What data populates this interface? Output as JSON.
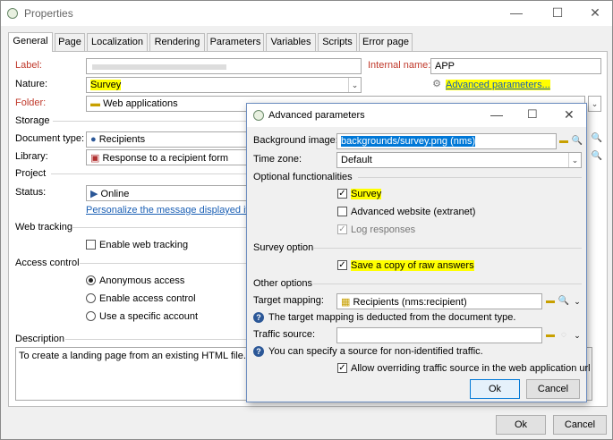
{
  "window": {
    "title": "Properties",
    "minimize": "—",
    "maximize": "☐",
    "close": "✕"
  },
  "tabs": [
    "General",
    "Page",
    "Localization",
    "Rendering",
    "Parameters",
    "Variables",
    "Scripts",
    "Error page"
  ],
  "general": {
    "label_label": "Label:",
    "label_value": "",
    "internal_name_label": "Internal name:",
    "internal_name_value": "APP",
    "nature_label": "Nature:",
    "nature_value": "Survey",
    "advanced_link": "Advanced parameters...",
    "folder_label": "Folder:",
    "folder_value": "Web applications",
    "storage_section": "Storage",
    "doctype_label": "Document type:",
    "doctype_value": "Recipients",
    "library_label": "Library:",
    "library_value": "Response to a recipient form",
    "project_section": "Project",
    "status_label": "Status:",
    "status_value": "Online",
    "personalize_link": "Personalize the message displayed if the",
    "webtracking_section": "Web tracking",
    "enable_tracking": "Enable web tracking",
    "access_section": "Access control",
    "anon_access": "Anonymous access",
    "enable_access": "Enable access control",
    "specific_account": "Use a specific account",
    "description_section": "Description",
    "description_value": "To create a landing page from an existing HTML file."
  },
  "dialog": {
    "title": "Advanced parameters",
    "bg_image_label": "Background image:",
    "bg_image_value": "backgrounds/survey.png (nms)",
    "timezone_label": "Time zone:",
    "timezone_value": "Default",
    "optional_section": "Optional functionalities",
    "survey_chk": "Survey",
    "adv_website_chk": "Advanced website (extranet)",
    "log_responses_chk": "Log responses",
    "survey_option_section": "Survey option",
    "save_copy_chk": "Save a copy of raw answers",
    "other_options_section": "Other options",
    "target_mapping_label": "Target mapping:",
    "target_mapping_value": "Recipients (nms:recipient)",
    "target_help": "The target mapping is deducted from the document type.",
    "traffic_label": "Traffic source:",
    "traffic_value": "",
    "traffic_help": "You can specify a source for non-identified traffic.",
    "allow_override_chk": "Allow overriding traffic source in the web application url",
    "ok": "Ok",
    "cancel": "Cancel"
  },
  "footer": {
    "ok": "Ok",
    "cancel": "Cancel"
  },
  "colors": {
    "highlight": "#ffff00",
    "required_label": "#c0392b",
    "link": "#1a5fb4"
  }
}
